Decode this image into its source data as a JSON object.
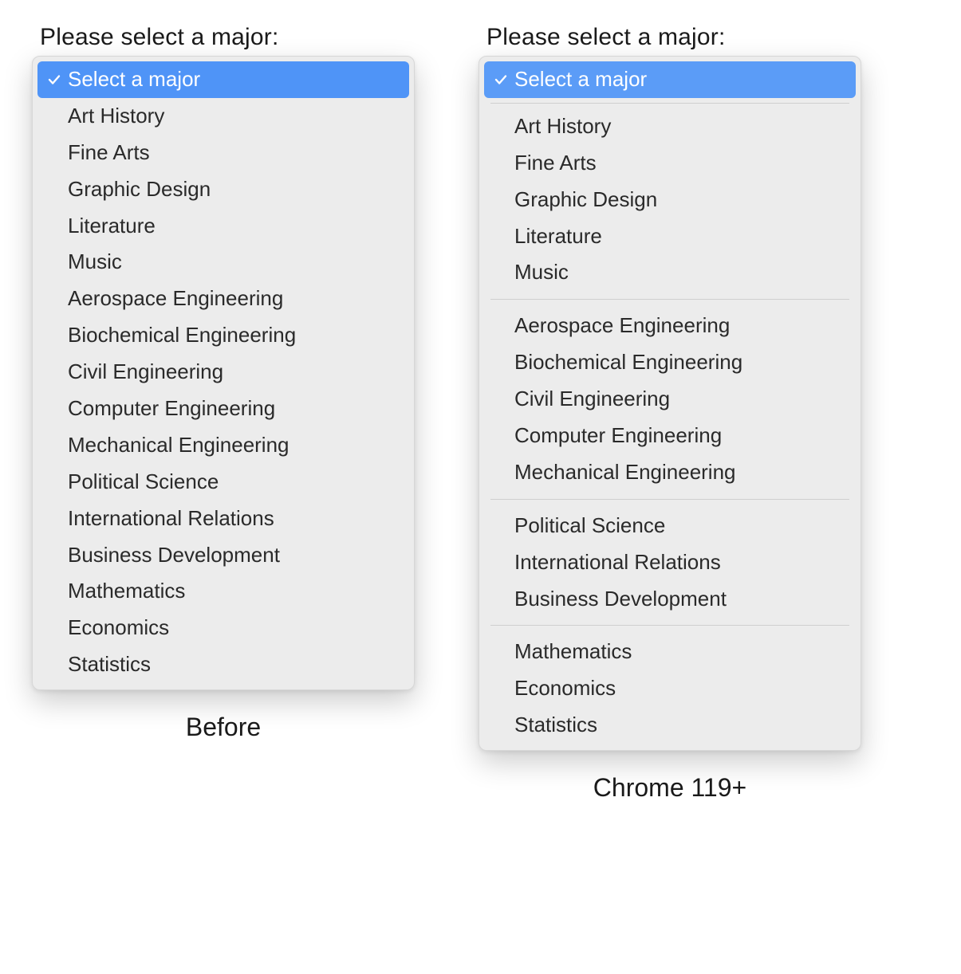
{
  "before": {
    "prompt_label": "Please select a major:",
    "selected_label": "Select a major",
    "options": [
      "Art History",
      "Fine Arts",
      "Graphic Design",
      "Literature",
      "Music",
      "Aerospace Engineering",
      "Biochemical Engineering",
      "Civil Engineering",
      "Computer Engineering",
      "Mechanical Engineering",
      "Political Science",
      "International Relations",
      "Business Development",
      "Mathematics",
      "Economics",
      "Statistics"
    ],
    "caption": "Before"
  },
  "after": {
    "prompt_label": "Please select a major:",
    "selected_label": "Select a major",
    "groups": [
      {
        "options": [
          "Art History",
          "Fine Arts",
          "Graphic Design",
          "Literature",
          "Music"
        ]
      },
      {
        "options": [
          "Aerospace Engineering",
          "Biochemical Engineering",
          "Civil Engineering",
          "Computer Engineering",
          "Mechanical Engineering"
        ]
      },
      {
        "options": [
          "Political Science",
          "International Relations",
          "Business Development"
        ]
      },
      {
        "options": [
          "Mathematics",
          "Economics",
          "Statistics"
        ]
      }
    ],
    "caption": "Chrome 119+"
  },
  "icons": {
    "check": "check-icon"
  }
}
